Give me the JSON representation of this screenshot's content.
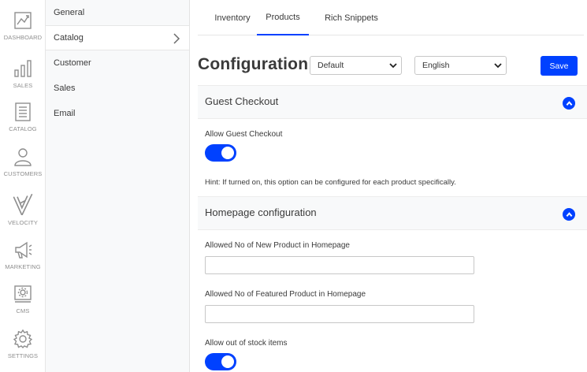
{
  "sidebar": {
    "items": [
      {
        "label": "DASHBOARD",
        "icon": "dashboard-icon"
      },
      {
        "label": "SALES",
        "icon": "bar-chart-icon"
      },
      {
        "label": "CATALOG",
        "icon": "catalog-icon"
      },
      {
        "label": "CUSTOMERS",
        "icon": "user-icon"
      },
      {
        "label": "VELOCITY",
        "icon": "velocity-icon"
      },
      {
        "label": "MARKETING",
        "icon": "megaphone-icon"
      },
      {
        "label": "CMS",
        "icon": "cms-icon"
      },
      {
        "label": "SETTINGS",
        "icon": "gear-icon"
      }
    ]
  },
  "submenu": {
    "items": [
      {
        "label": "General"
      },
      {
        "label": "Catalog",
        "active": true
      },
      {
        "label": "Customer"
      },
      {
        "label": "Sales"
      },
      {
        "label": "Email"
      }
    ]
  },
  "tabs": [
    {
      "label": "Inventory"
    },
    {
      "label": "Products",
      "active": true
    },
    {
      "label": "Rich Snippets"
    }
  ],
  "header": {
    "title": "Configuration",
    "channel_select": "Default",
    "locale_select": "English",
    "save_label": "Save"
  },
  "sections": {
    "guest": {
      "title": "Guest Checkout",
      "allow_label": "Allow Guest Checkout",
      "allow_value": true,
      "hint": "Hint: If turned on, this option can be configured for each product specifically."
    },
    "homepage": {
      "title": "Homepage configuration",
      "new_label": "Allowed No of New Product in Homepage",
      "new_value": "",
      "featured_label": "Allowed No of Featured Product in Homepage",
      "featured_value": "",
      "oos_label": "Allow out of stock items",
      "oos_value": true
    }
  },
  "colors": {
    "accent": "#0041ff",
    "sidebar_bg": "#f8f9fa",
    "icon": "#8e8e8e"
  }
}
